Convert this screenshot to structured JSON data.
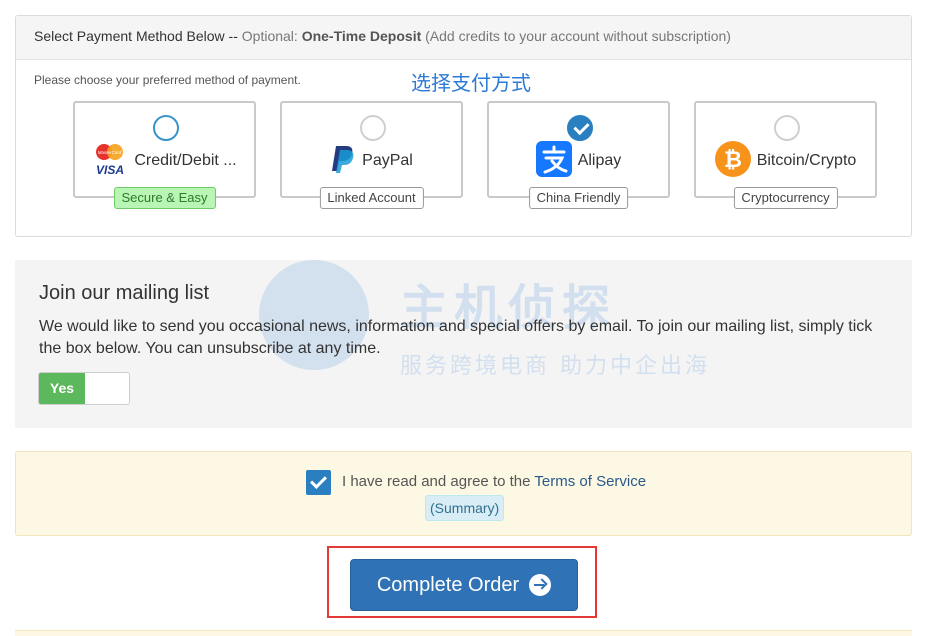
{
  "payment": {
    "heading_main": "Select Payment Method Below --",
    "heading_optional": "Optional:",
    "heading_bold": "One-Time Deposit",
    "heading_paren": "(Add credits to your account without subscription)",
    "choose_note": "Please choose your preferred method of payment.",
    "cn_overlay": "选择支付方式",
    "options": [
      {
        "label": "Credit/Debit ...",
        "badge": "Secure & Easy",
        "state": "focused",
        "icon": "credit-card-icon"
      },
      {
        "label": "PayPal",
        "badge": "Linked Account",
        "state": "unchecked",
        "icon": "paypal-icon"
      },
      {
        "label": "Alipay",
        "badge": "China Friendly",
        "state": "checked",
        "icon": "alipay-icon"
      },
      {
        "label": "Bitcoin/Crypto",
        "badge": "Cryptocurrency",
        "state": "unchecked",
        "icon": "bitcoin-icon"
      }
    ],
    "card_logo_mastercard": "MasterCard",
    "card_logo_visa": "VISA"
  },
  "mailing": {
    "title": "Join our mailing list",
    "text": "We would like to send you occasional news, information and special offers by email. To join our mailing list, simply tick the box below. You can unsubscribe at any time.",
    "toggle_label": "Yes",
    "watermark_line1": "主机侦探",
    "watermark_line2": "服务跨境电商 助力中企出海"
  },
  "terms": {
    "agree_text": "I have read and agree to the",
    "tos_link": "Terms of Service",
    "summary": "(Summary)"
  },
  "order": {
    "button_label": "Complete Order"
  },
  "colors": {
    "primary": "#2f72b5",
    "success": "#5cb85c",
    "highlight": "#e53935"
  }
}
